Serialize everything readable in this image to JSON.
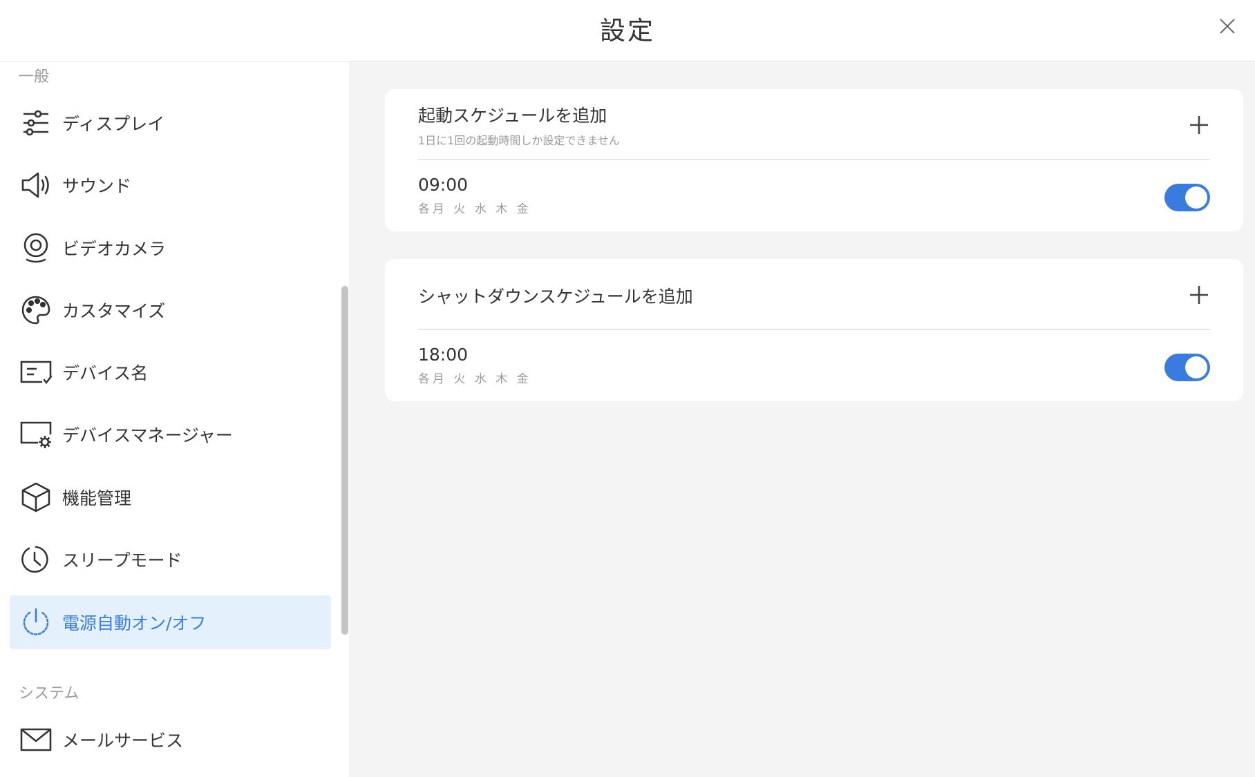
{
  "header": {
    "title": "設定"
  },
  "sidebar": {
    "section_general": "一般",
    "items": [
      {
        "label": "ディスプレイ",
        "icon": "sliders-icon"
      },
      {
        "label": "サウンド",
        "icon": "speaker-icon"
      },
      {
        "label": "ビデオカメラ",
        "icon": "webcam-icon"
      },
      {
        "label": "カスタマイズ",
        "icon": "palette-icon"
      },
      {
        "label": "デバイス名",
        "icon": "device-name-icon"
      },
      {
        "label": "デバイスマネージャー",
        "icon": "device-manager-icon"
      },
      {
        "label": "機能管理",
        "icon": "cube-icon"
      },
      {
        "label": "スリープモード",
        "icon": "clock-icon"
      },
      {
        "label": "電源自動オン/オフ",
        "icon": "power-icon",
        "active": true
      }
    ],
    "section_system": "システム",
    "system_items": [
      {
        "label": "メールサービス",
        "icon": "mail-icon"
      }
    ]
  },
  "startup": {
    "title": "起動スケジュールを追加",
    "subtitle": "1日に1回の起動時間しか設定できません",
    "entry": {
      "time": "09:00",
      "days": "各月 火 水 木 金",
      "enabled": true
    }
  },
  "shutdown": {
    "title": "シャットダウンスケジュールを追加",
    "entry": {
      "time": "18:00",
      "days": "各月 火 水 木 金",
      "enabled": true
    }
  },
  "colors": {
    "accent": "#3a7bde",
    "active_bg": "#e4f1fd",
    "content_bg": "#f4f4f4"
  }
}
